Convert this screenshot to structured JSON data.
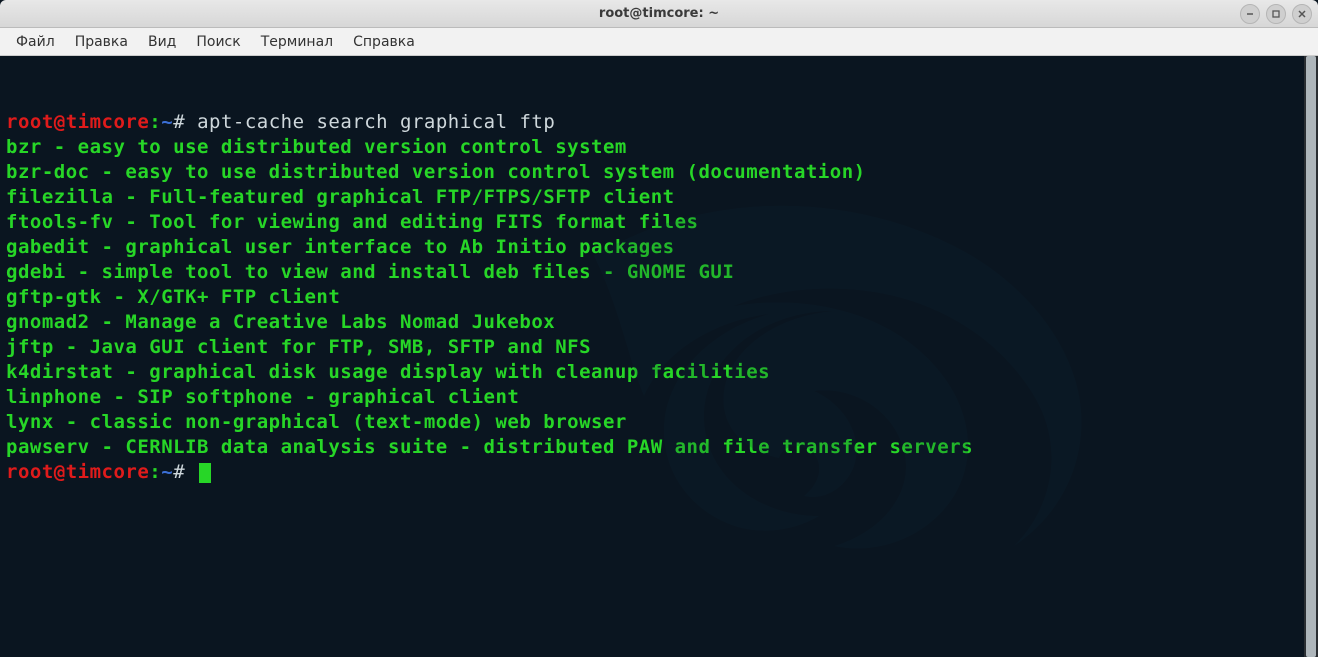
{
  "window": {
    "title": "root@timcore: ~"
  },
  "menu": {
    "file": "Файл",
    "edit": "Правка",
    "view": "Вид",
    "search": "Поиск",
    "terminal": "Терминал",
    "help": "Справка"
  },
  "prompt": {
    "user_host": "root@timcore",
    "sep": ":",
    "path": "~",
    "hash": "#"
  },
  "term": {
    "cmd1": "apt-cache search graphical ftp",
    "out": [
      "bzr - easy to use distributed version control system",
      "bzr-doc - easy to use distributed version control system (documentation)",
      "filezilla - Full-featured graphical FTP/FTPS/SFTP client",
      "ftools-fv - Tool for viewing and editing FITS format files",
      "gabedit - graphical user interface to Ab Initio packages",
      "gdebi - simple tool to view and install deb files - GNOME GUI",
      "gftp-gtk - X/GTK+ FTP client",
      "gnomad2 - Manage a Creative Labs Nomad Jukebox",
      "jftp - Java GUI client for FTP, SMB, SFTP and NFS",
      "k4dirstat - graphical disk usage display with cleanup facilities",
      "linphone - SIP softphone - graphical client",
      "lynx - classic non-graphical (text-mode) web browser",
      "pawserv - CERNLIB data analysis suite - distributed PAW and file transfer servers"
    ]
  }
}
